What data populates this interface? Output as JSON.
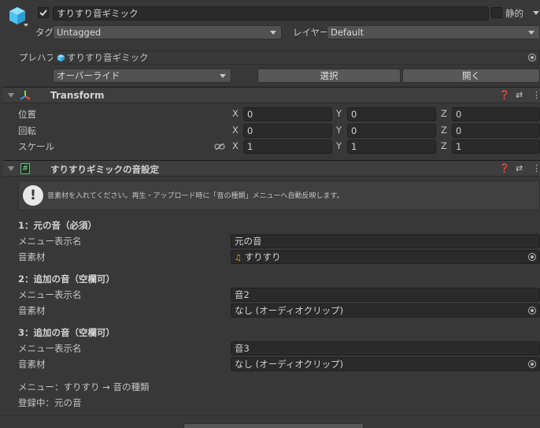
{
  "object": {
    "name": "すりすり音ギミック",
    "active_checked": true,
    "static_label": "静的",
    "tag_label": "タグ",
    "tag_value": "Untagged",
    "layer_label": "レイヤー",
    "layer_value": "Default"
  },
  "prefab": {
    "label": "プレハブ",
    "asset_name": "すりすり音ギミック",
    "overrides_label": "オーバーライド",
    "select_label": "選択",
    "open_label": "開く"
  },
  "transform": {
    "title": "Transform",
    "position_label": "位置",
    "rotation_label": "回転",
    "scale_label": "スケール",
    "position": {
      "x": "0",
      "y": "0",
      "z": "0"
    },
    "rotation": {
      "x": "0",
      "y": "0",
      "z": "0"
    },
    "scale": {
      "x": "1",
      "y": "1",
      "z": "1"
    },
    "axis_x": "X",
    "axis_y": "Y",
    "axis_z": "Z"
  },
  "component": {
    "title": "すりすりギミックの音設定",
    "help_message": "音素材を入れてください。再生・アップロード時に「音の種類」メニューへ自動反映します。",
    "sections": [
      {
        "heading": "1：元の音（必須）",
        "menu_label": "メニュー表示名",
        "menu_value": "元の音",
        "clip_label": "音素材",
        "clip_value": "すりすり"
      },
      {
        "heading": "2：追加の音（空欄可）",
        "menu_label": "メニュー表示名",
        "menu_value": "音2",
        "clip_label": "音素材",
        "clip_value": "なし (オーディオクリップ)"
      },
      {
        "heading": "3：追加の音（空欄可）",
        "menu_label": "メニュー表示名",
        "menu_value": "音3",
        "clip_label": "音素材",
        "clip_value": "なし (オーディオクリップ)"
      }
    ],
    "menu_path": "メニュー：すりすり → 音の種類",
    "registered": "登録中：元の音"
  },
  "colors": {
    "background": "#383838",
    "field": "#2a2a2a",
    "button": "#585858",
    "cube_icon": "#4fc3f7",
    "script_icon": "#5fbf6f",
    "audio_icon": "#e8a13a"
  }
}
